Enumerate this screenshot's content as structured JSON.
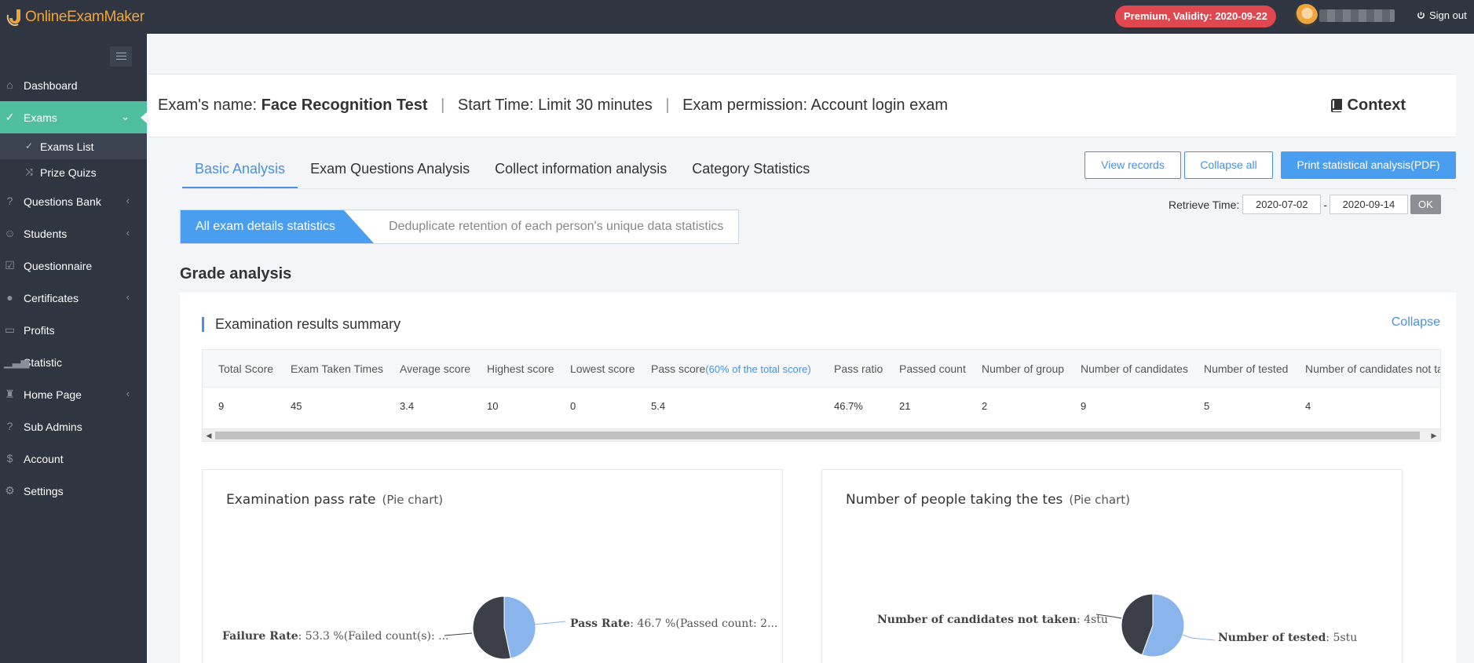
{
  "brand": {
    "name": "OnlineExamMaker"
  },
  "topbar": {
    "premium_badge": "Premium, Validity: 2020-09-22",
    "signout_label": "Sign out"
  },
  "sidebar": {
    "items": [
      {
        "label": "Dashboard",
        "icon": "home-icon"
      },
      {
        "label": "Exams",
        "icon": "check-circle-icon",
        "active": true
      },
      {
        "label": "Questions Bank",
        "icon": "question-circle-icon"
      },
      {
        "label": "Students",
        "icon": "users-icon"
      },
      {
        "label": "Questionnaire",
        "icon": "checkbox-icon"
      },
      {
        "label": "Certificates",
        "icon": "badge-icon"
      },
      {
        "label": "Profits",
        "icon": "card-icon"
      },
      {
        "label": "Statistic",
        "icon": "bar-chart-icon"
      },
      {
        "label": "Home Page",
        "icon": "stamp-icon"
      },
      {
        "label": "Sub Admins",
        "icon": "question-circle-icon"
      },
      {
        "label": "Account",
        "icon": "dollar-icon"
      },
      {
        "label": "Settings",
        "icon": "gear-icon"
      }
    ],
    "sub_items": [
      {
        "label": "Exams List"
      },
      {
        "label": "Prize Quizs"
      }
    ]
  },
  "exam": {
    "name_label": "Exam's name:",
    "name": "Face Recognition Test",
    "start_time": "Start Time: Limit 30 minutes",
    "permission": "Exam permission: Account login exam",
    "context_label": "Context"
  },
  "tabs": [
    {
      "label": "Basic Analysis",
      "active": true
    },
    {
      "label": "Exam Questions Analysis"
    },
    {
      "label": "Collect information analysis"
    },
    {
      "label": "Category Statistics"
    }
  ],
  "actions": {
    "view_records": "View records",
    "collapse_all": "Collapse all",
    "print_pdf": "Print statistical analysis(PDF)"
  },
  "retrieve": {
    "label": "Retrieve Time:",
    "start": "2020-07-02",
    "separator": "-",
    "end": "2020-09-14",
    "ok_label": "OK"
  },
  "segments": {
    "active": "All exam details statistics",
    "other": "Deduplicate retention of each person's unique data statistics"
  },
  "grade_analysis": {
    "title": "Grade analysis",
    "summary_title": "Examination results summary",
    "collapse_label": "Collapse",
    "columns": [
      "Total Score",
      "Exam Taken Times",
      "Average score",
      "Highest score",
      "Lowest score",
      "Pass score",
      "Pass ratio",
      "Passed count",
      "Number of group",
      "Number of candidates",
      "Number of tested",
      "Number of candidates not ta"
    ],
    "pass_score_note": "(60% of the total score)",
    "row": [
      "9",
      "45",
      "3.4",
      "10",
      "0",
      "5.4",
      "46.7%",
      "21",
      "2",
      "9",
      "5",
      "4"
    ]
  },
  "charts": {
    "pass_rate": {
      "title": "Examination pass rate",
      "subtitle": "(Pie chart)",
      "pass_label": "Pass Rate",
      "pass_text": ": 46.7 %(Passed count: 2...",
      "fail_label": "Failure Rate",
      "fail_text": ": 53.3 %(Failed count(s): ..."
    },
    "taking": {
      "title": "Number of people taking the tes",
      "subtitle": "(Pie chart)",
      "not_taken_label": "Number of candidates not taken",
      "not_taken_text": ": 4stu",
      "tested_label": "Number of tested",
      "tested_text": ": 5stu"
    }
  },
  "chart_data": [
    {
      "type": "pie",
      "title": "Examination pass rate",
      "labels": [
        "Pass Rate",
        "Failure Rate"
      ],
      "values": [
        46.7,
        53.3
      ],
      "colors": [
        "#8ab4ec",
        "#3c3f47"
      ]
    },
    {
      "type": "pie",
      "title": "Number of people taking the tes",
      "labels": [
        "Number of tested",
        "Number of candidates not taken"
      ],
      "values": [
        5,
        4
      ],
      "colors": [
        "#8ab4ec",
        "#3c3f47"
      ]
    }
  ],
  "colors": {
    "sidebar_bg": "#2f3541",
    "active_green": "#4fbf9f",
    "accent_blue": "#4a90e2",
    "premium_red": "#e0474e",
    "brand_orange": "#f0a53b"
  }
}
